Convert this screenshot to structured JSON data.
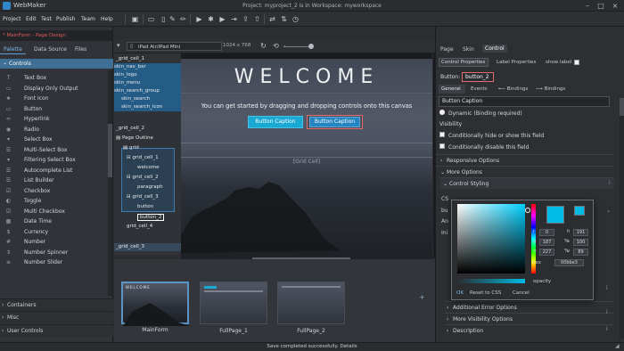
{
  "titlebar": {
    "app_name": "WebMaker",
    "project_text": "Project: myproject_2 is in Workspace: myworkspace"
  },
  "menu": [
    "Project",
    "Edit",
    "Test",
    "Publish",
    "Team",
    "Help"
  ],
  "left": {
    "breadcrumb": "* MainForm - Page Design",
    "tabs": [
      "Palette",
      "Data Source",
      "Files"
    ],
    "section": "Controls",
    "controls": [
      {
        "label": "Text Box",
        "icon": "T"
      },
      {
        "label": "Display Only Output",
        "icon": "▭"
      },
      {
        "label": "Font Icon",
        "icon": "★"
      },
      {
        "label": "Button",
        "icon": "▭"
      },
      {
        "label": "Hyperlink",
        "icon": "∞"
      },
      {
        "label": "Radio",
        "icon": "◉"
      },
      {
        "label": "Select Box",
        "icon": "▾"
      },
      {
        "label": "Multi-Select Box",
        "icon": "☰"
      },
      {
        "label": "Filtering Select Box",
        "icon": "▾"
      },
      {
        "label": "Autocomplete List",
        "icon": "☰"
      },
      {
        "label": "List Builder",
        "icon": "☰"
      },
      {
        "label": "Checkbox",
        "icon": "☑"
      },
      {
        "label": "Toggle",
        "icon": "◐"
      },
      {
        "label": "Multi Checkbox",
        "icon": "☑"
      },
      {
        "label": "Date Time",
        "icon": "▦"
      },
      {
        "label": "Currency",
        "icon": "$"
      },
      {
        "label": "Number",
        "icon": "#"
      },
      {
        "label": "Number Spinner",
        "icon": "⇕"
      },
      {
        "label": "Number Slider",
        "icon": "≡"
      }
    ],
    "accordions": [
      "Containers",
      "Misc",
      "User Controls"
    ]
  },
  "toolbar2": {
    "device": "iPad Air/iPad Mini",
    "resolution": "1024 x 768"
  },
  "outline": {
    "top_items": [
      "_grid_cell_1",
      "skin_nav_bar",
      "skin_logo",
      "skin_menu",
      "skin_search_group",
      "skin_search",
      "skin_search_icon"
    ],
    "mid_items": [
      "_grid_cell_2",
      "Page Outline",
      "grid",
      "grid_cell_1",
      "welcome",
      "grid_cell_2",
      "paragraph",
      "grid_cell_3",
      "button",
      "button_2",
      "grid_cell_4"
    ],
    "bottom_item": "_grid_cell_3"
  },
  "canvas": {
    "heading": "WELCOME",
    "paragraph": "You can get started by dragging and dropping controls onto this canvas",
    "button1": "Button Caption",
    "button2": "Button Caption",
    "grid_label": "[Grid Cell]"
  },
  "thumbnails": [
    {
      "label": "MainForm",
      "mini": "WELCOME"
    },
    {
      "label": "FullPage_1",
      "mini": ""
    },
    {
      "label": "FullPage_2",
      "mini": ""
    }
  ],
  "right": {
    "tabs": [
      "Page",
      "Skin",
      "Control"
    ],
    "subtabs": [
      "Control Properties",
      "Label Properties",
      "show label"
    ],
    "control_type": "Button:",
    "control_name": "button_2",
    "prop_tabs": [
      "General",
      "Events",
      "Bindings",
      "Bindings"
    ],
    "caption_value": "Button Caption",
    "dynamic_label": "Dynamic (Binding required)",
    "visibility_label": "Visibility",
    "cond_hide": "Conditionally hide or show this field",
    "cond_disable": "Conditionally disable this field",
    "sections": [
      "Responsive Options",
      "More Options",
      "Control Styling"
    ],
    "lower_sections": [
      "Additional Error Options",
      "More Visibility Options",
      "Description"
    ],
    "partial_labels": [
      "CS",
      "bu",
      "An",
      "Ini"
    ]
  },
  "colorpicker": {
    "fields": [
      {
        "k": "r",
        "v": "0"
      },
      {
        "k": "g",
        "v": "187"
      },
      {
        "k": "b",
        "v": "227"
      },
      {
        "k": "h",
        "v": "191"
      },
      {
        "k": "s",
        "v": "100"
      },
      {
        "k": "v",
        "v": "89"
      }
    ],
    "pct1": "%",
    "pct2": "%",
    "hex_label": "hex",
    "hex_value": "00bbe3",
    "opacity_label": "opacity",
    "buttons": [
      "OK",
      "Reset to CSS",
      "Cancel"
    ],
    "colors": {
      "main": "#00bbe3"
    }
  },
  "status": "Save completed successfully. Details"
}
